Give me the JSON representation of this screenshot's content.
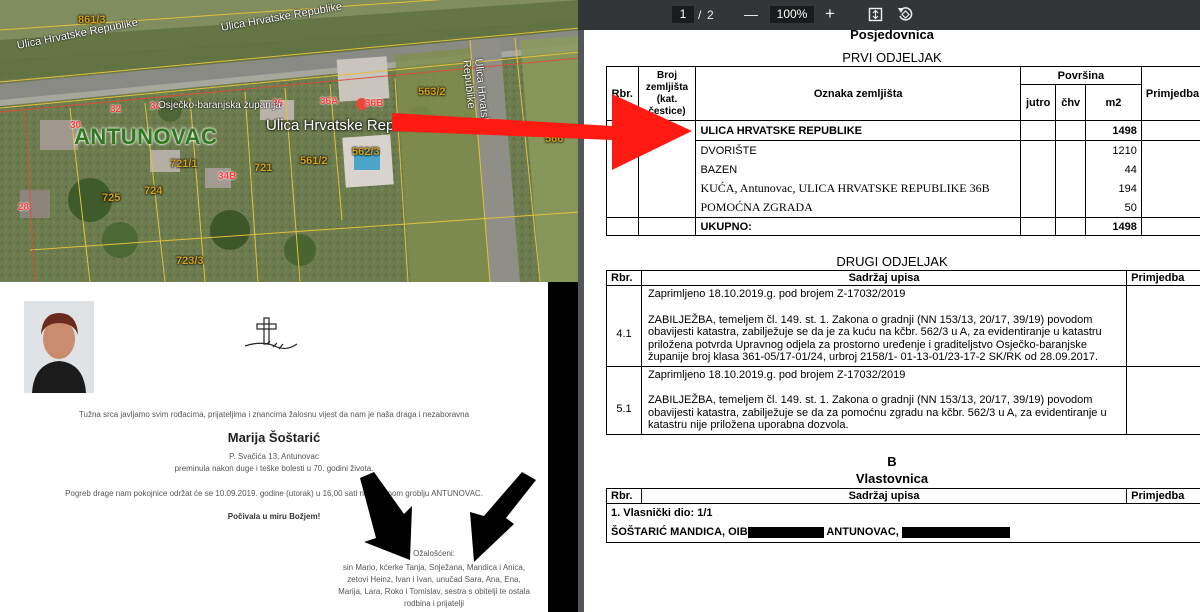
{
  "map": {
    "place_name": "ANTUNOVAC",
    "streets": [
      {
        "name": "Ulica Hrvatske Republike"
      },
      {
        "name": "Ulica Hrvatske Republike"
      },
      {
        "name": "Ulica Hrvatske Republike"
      }
    ],
    "county_label": "Osječko-baranjska županija",
    "location_callout": "Ulica Hrvatske Republike 36B",
    "parcels": [
      "861/3",
      "563/2",
      "721/1",
      "721",
      "561/2",
      "562/3",
      "725",
      "724",
      "723/3",
      "566"
    ],
    "house_numbers": [
      "32",
      "34",
      "36",
      "36A",
      "36B",
      "30",
      "28",
      "34B"
    ]
  },
  "obituary": {
    "intro": "Tužna srca javljamo svim rođacima, prijateljima i znancima žalosnu vijest da nam je naša draga i nezaboravna",
    "name": "Marija Šoštarić",
    "address": "P. Svačića 13, Antunovac",
    "death_line": "preminula nakon duge i teške bolesti u 70. godini života.",
    "funeral_line": "Pogreb drage nam pokojnice održat će se 10.09.2019. godine (utorak) u 16,00 sati na mjesnom groblju ANTUNOVAC.",
    "rest_line": "Počivala u miru Božjem!",
    "mourners_title": "Ožalošćeni:",
    "mourners_lines": [
      "sin Mario, kćerke Tanja, Snježana, Mandica i Anica,",
      "zetovi Heinz, Ivan i Ivan, unučad Sara, Ana, Ena,",
      "Marija, Lara, Roko i Tomislav, sestra s obitelji te ostala",
      "rodbina i prijatelji"
    ]
  },
  "pdf_viewer": {
    "page_current": "1",
    "page_separator": "/",
    "page_total": "2",
    "zoom": "100%",
    "zoom_out": "—",
    "zoom_in": "+"
  },
  "document": {
    "header_cut": "Posjedovnica",
    "section1_title": "PRVI ODJELJAK",
    "table1": {
      "headers": {
        "rbr": "Rbr.",
        "broj": "Broj zemljišta (kat. čestice)",
        "oznaka": "Oznaka zemljišta",
        "povrsina": "Površina",
        "jutro": "jutro",
        "chv": "čhv",
        "m2": "m2",
        "primjedba": "Primjedba"
      },
      "parcel_number_visible": "3",
      "rows": [
        {
          "label": "ULICA HRVATSKE REPUBLIKE",
          "m2": "1498",
          "bold": true
        },
        {
          "label": "DVORIŠTE",
          "m2": "1210",
          "bold": false
        },
        {
          "label": "BAZEN",
          "m2": "44",
          "bold": false
        },
        {
          "label": "KUĆA, Antunovac, ULICA HRVATSKE REPUBLIKE 36B",
          "m2": "194",
          "bold": false
        },
        {
          "label": "POMOĆNA ZGRADA",
          "m2": "50",
          "bold": false
        }
      ],
      "total_label": "UKUPNO:",
      "total_m2": "1498"
    },
    "section2_title": "DRUGI ODJELJAK",
    "table2": {
      "headers": {
        "rbr": "Rbr.",
        "sadrzaj": "Sadržaj upisa",
        "primjedba": "Primjedba"
      },
      "entries": [
        {
          "rbr": "4.1",
          "received": "Zaprimljeno 18.10.2019.g. pod brojem Z-17032/2019",
          "text": "ZABILJEŽBA, temeljem čl. 149. st. 1. Zakona o gradnji (NN 153/13, 20/17, 39/19) povodom obavijesti katastra, zabilježuje se da je za kuću na kčbr. 562/3 u A, za evidentiranje u katastru priložena potvrda Upravnog odjela za prostorno uređenje i graditeljstvo Osječko-baranjske županije broj klasa 361-05/17-01/24, urbroj 2158/1- 01-13-01/23-17-2 SK/RK od 28.09.2017."
        },
        {
          "rbr": "5.1",
          "received": "Zaprimljeno 18.10.2019.g. pod brojem Z-17032/2019",
          "text": "ZABILJEŽBA, temeljem čl. 149. st. 1. Zakona o gradnji (NN 153/13, 20/17, 39/19) povodom obavijesti katastra, zabilježuje se da za pomoćnu zgradu na kčbr. 562/3 u A, za evidentiranje u katastru nije priložena uporabna dozvola."
        }
      ]
    },
    "section3_letter": "B",
    "section3_title": "Vlastovnica",
    "table3": {
      "headers": {
        "rbr": "Rbr.",
        "sadrzaj": "Sadržaj upisa",
        "primjedba": "Primjedba"
      },
      "share_line": "1. Vlasnički dio: 1/1",
      "owner_prefix": "ŠOŠTARIĆ MANDICA, OIB",
      "owner_mid": "ANTUNOVAC,"
    }
  },
  "colors": {
    "annotation_arrow": "#ff1a12",
    "parcel_label": "#d4a11a",
    "house_number": "#ff3a3a",
    "place_name": "#2f7a1d",
    "viewer_toolbar": "#323639",
    "viewer_bg": "#525659"
  }
}
